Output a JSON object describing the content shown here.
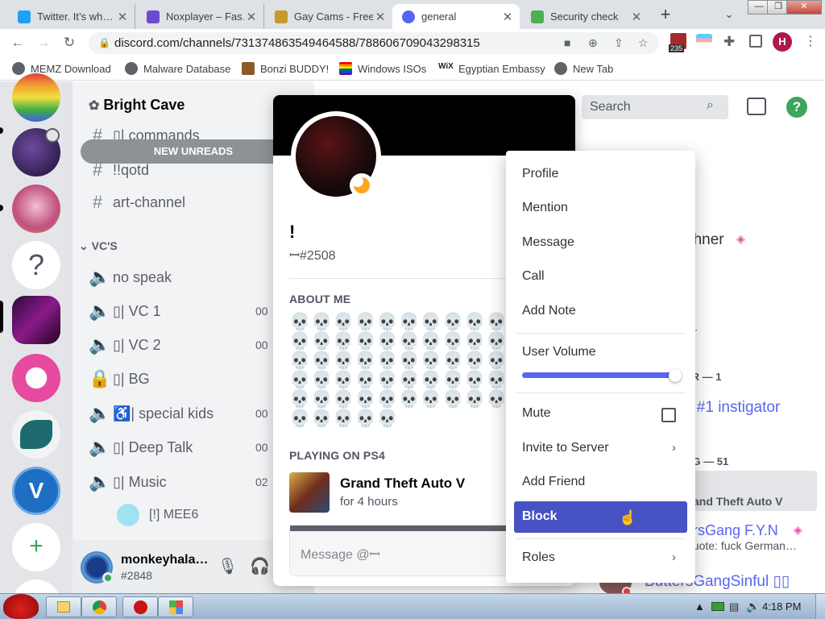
{
  "browser": {
    "tabs": [
      {
        "title": "Twitter. It’s wh…",
        "icon_color": "#1da1f2",
        "icon": "twitter-icon"
      },
      {
        "title": "Noxplayer – Fas…",
        "icon_color": "#6c4bd1",
        "icon": "noxplayer-icon"
      },
      {
        "title": "Gay Cams - Free",
        "icon_color": "#c49a2c",
        "icon": "site-icon"
      },
      {
        "title": "general",
        "icon_color": "#5865f2",
        "icon": "discord-icon"
      },
      {
        "title": "Security check",
        "icon_color": "#4caf50",
        "icon": "security-icon"
      }
    ],
    "new_tab": "+",
    "url": "discord.com/channels/731374863549464588/788606709043298315",
    "extension_badge": "235",
    "profile_initial": "H",
    "bookmarks": [
      "MEMZ Download",
      "Malware Database",
      "Bonzi BUDDY!",
      "Windows ISOs",
      "Egyptian Embassy",
      "New Tab"
    ]
  },
  "discord": {
    "server_name": "Bright Cave",
    "new_unreads": "NEW UNREADS",
    "channels": [
      {
        "name": "▯| commands",
        "type": "text"
      },
      {
        "name": "!!qotd",
        "type": "text"
      },
      {
        "name": "art-channel",
        "type": "text-thread"
      }
    ],
    "category": "VC'S",
    "voice_channels": [
      {
        "name": "no speak",
        "type": "voice",
        "count": ""
      },
      {
        "name": "▯| VC 1",
        "type": "voice",
        "count": "00"
      },
      {
        "name": "▯| VC 2",
        "type": "voice",
        "count": "00"
      },
      {
        "name": "▯| BG",
        "type": "locked",
        "count": ""
      },
      {
        "name": "♿| special kids",
        "type": "stage",
        "count": "00"
      },
      {
        "name": "▯| Deep Talk",
        "type": "voice",
        "count": "00"
      },
      {
        "name": "▯| Music",
        "type": "stage",
        "count": "02"
      }
    ],
    "voice_member": "[!] MEE6",
    "user": {
      "name": "monkeyhala…",
      "tag": "#2848"
    },
    "search_placeholder": "Search",
    "member_list": {
      "name_1": "ohner",
      "subtitle_1": "tar",
      "group_1": "ER — 1",
      "member_instigator": "s #1 instigator",
      "group_2": "NG — 51",
      "activity": "and Theft Auto V",
      "member_fyn": "ersGang F.Y.N",
      "quote": "quote: fuck German…",
      "member_sinful": "ButtersGangSinful ▯▯"
    },
    "profile": {
      "name": "!",
      "tag": "ꟷ#2508",
      "about_heading": "ABOUT ME",
      "about_text": "💀💀💀💀💀💀💀💀💀💀💀💀💀💀💀💀💀💀💀💀💀💀💀💀💀💀💀💀💀💀💀💀💀💀💀💀💀💀💀💀💀💀💀💀💀💀💀💀💀💀💀💀💀💀💀💀💀💀💀💀",
      "playing_heading": "PLAYING ON PS4",
      "game": "Grand Theft Auto V",
      "game_time": "for 4 hours",
      "message_placeholder": "Message @ꟷ"
    },
    "context_menu": {
      "items": [
        "Profile",
        "Mention",
        "Message",
        "Call",
        "Add Note"
      ],
      "user_volume": "User Volume",
      "volume_level": 0.95,
      "mute": "Mute",
      "invite": "Invite to Server",
      "add_friend": "Add Friend",
      "block": "Block",
      "roles": "Roles"
    }
  },
  "taskbar": {
    "time": "4:18 PM"
  }
}
